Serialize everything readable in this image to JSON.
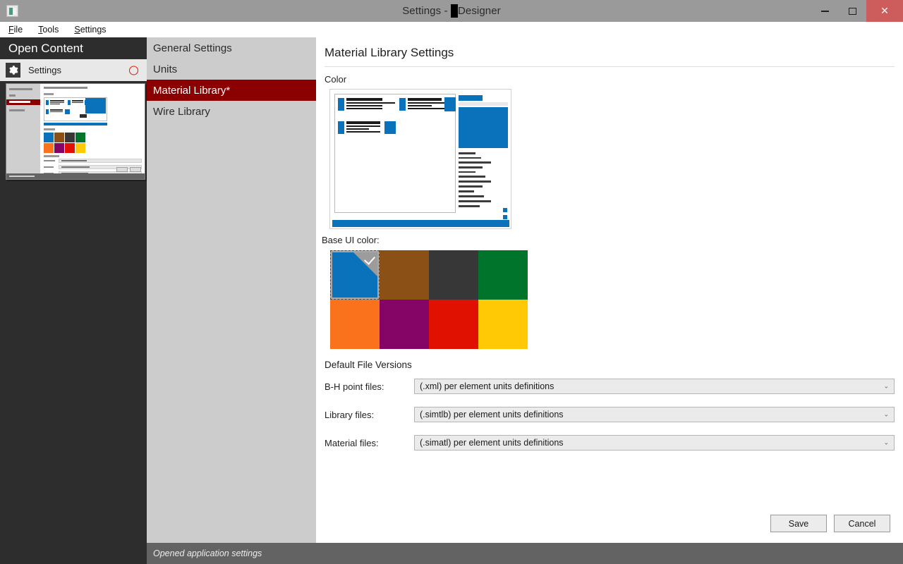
{
  "window": {
    "title_prefix": "Settings -",
    "title_redacted": "S                                    ",
    "title_suffix": "Designer",
    "app_icon": "application-icon",
    "minimize_label": "Minimize",
    "maximize_label": "Maximize",
    "close_label": "✕"
  },
  "menubar": {
    "items": [
      {
        "label": "File",
        "accel": "F"
      },
      {
        "label": "Tools",
        "accel": "T"
      },
      {
        "label": "Settings",
        "accel": "S"
      }
    ]
  },
  "sidebar": {
    "header": "Open Content",
    "entry": {
      "label": "Settings",
      "icon": "gear-icon",
      "close_icon": "close-ring-icon"
    }
  },
  "nav": {
    "items": [
      {
        "label": "General Settings",
        "active": false
      },
      {
        "label": "Units",
        "active": false
      },
      {
        "label": "Material Library*",
        "active": true
      },
      {
        "label": "Wire Library",
        "active": false
      }
    ]
  },
  "main": {
    "page_title": "Material Library Settings",
    "color_section_label": "Color",
    "base_ui_color_label": "Base UI color:",
    "swatches": [
      {
        "name": "blue",
        "hex": "#0a72bb",
        "selected": true
      },
      {
        "name": "brown",
        "hex": "#8b5016",
        "selected": false
      },
      {
        "name": "dark-gray",
        "hex": "#373737",
        "selected": false
      },
      {
        "name": "green",
        "hex": "#00742b",
        "selected": false
      },
      {
        "name": "orange",
        "hex": "#fb721c",
        "selected": false
      },
      {
        "name": "magenta",
        "hex": "#850566",
        "selected": false
      },
      {
        "name": "red",
        "hex": "#e01100",
        "selected": false
      },
      {
        "name": "yellow",
        "hex": "#ffca05",
        "selected": false
      }
    ],
    "default_file_versions": {
      "label": "Default File Versions",
      "rows": [
        {
          "name": "B-H point files:",
          "value": "(.xml) per element units definitions"
        },
        {
          "name": "Library files:",
          "value": "(.simtlb) per element units definitions"
        },
        {
          "name": "Material files:",
          "value": "(.simatl) per element units definitions"
        }
      ],
      "chevron": "⌄"
    },
    "buttons": {
      "save": "Save",
      "cancel": "Cancel"
    }
  },
  "statusbar": {
    "message": "Opened application settings"
  }
}
